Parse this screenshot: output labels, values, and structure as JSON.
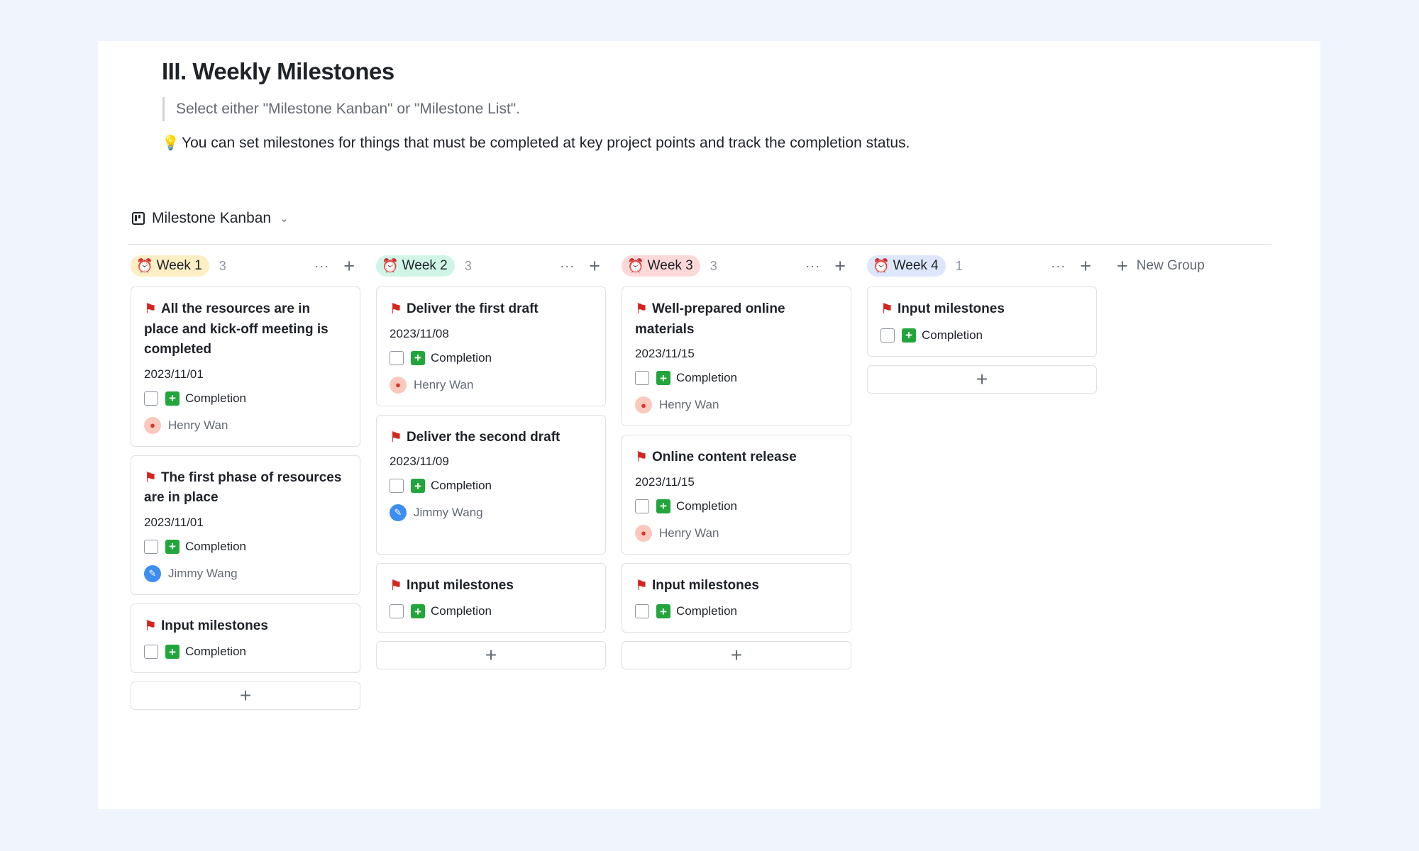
{
  "heading": "III. Weekly Milestones",
  "quote": "Select either \"Milestone Kanban\" or \"Milestone List\".",
  "tip": {
    "icon": "lightbulb-icon",
    "text": "You can set milestones for things that must be completed at key project points and track the completion status."
  },
  "view": {
    "label": "Milestone Kanban",
    "icon": "kanban-icon"
  },
  "columns": [
    {
      "label": "Week 1",
      "count": "3",
      "tag_color": "#fdefc3",
      "cards": [
        {
          "title": "All the resources are in place and kick-off meeting is completed",
          "date": "2023/11/01",
          "check": "Completion",
          "user": "Henry Wan"
        },
        {
          "title": "The first phase of resources are in place",
          "date": "2023/11/01",
          "check": "Completion",
          "user": "Jimmy Wang"
        },
        {
          "title": "Input milestones",
          "check": "Completion"
        }
      ]
    },
    {
      "label": "Week 2",
      "count": "3",
      "tag_color": "#d0f5e7",
      "cards": [
        {
          "title": "Deliver the first draft",
          "date": "2023/11/08",
          "check": "Completion",
          "user": "Henry Wan"
        },
        {
          "title": "Deliver the second draft",
          "date": "2023/11/09",
          "check": "Completion",
          "user": "Jimmy Wang"
        },
        {
          "title": "Input milestones",
          "check": "Completion"
        }
      ]
    },
    {
      "label": "Week 3",
      "count": "3",
      "tag_color": "#fdd8d8",
      "cards": [
        {
          "title": "Well-prepared online materials",
          "date": "2023/11/15",
          "check": "Completion",
          "user": "Henry Wan"
        },
        {
          "title": "Online content release",
          "date": "2023/11/15",
          "check": "Completion",
          "user": "Henry Wan"
        },
        {
          "title": "Input milestones",
          "check": "Completion"
        }
      ]
    },
    {
      "label": "Week 4",
      "count": "1",
      "tag_color": "#dde6fb",
      "cards": [
        {
          "title": "Input milestones",
          "check": "Completion"
        }
      ]
    }
  ],
  "new_group": "New Group"
}
